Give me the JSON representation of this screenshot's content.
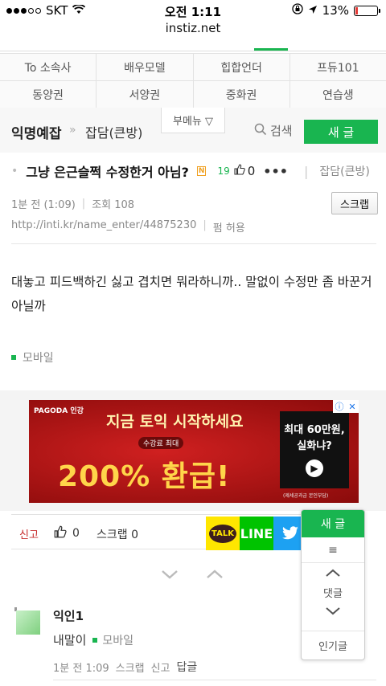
{
  "status_bar": {
    "carrier": "SKT",
    "time": "오전 1:11",
    "battery": "13%",
    "battery_level": 0.13
  },
  "browser": {
    "url": "instiz.net"
  },
  "categories": [
    [
      "To 소속사",
      "배우모델",
      "힙합언더",
      "프듀101"
    ],
    [
      "동양권",
      "서양권",
      "중화권",
      "연습생"
    ]
  ],
  "board": {
    "title": "익명예잡",
    "separator": "»",
    "sub": "잡담(큰방)",
    "submenu": "부메뉴 ▽",
    "search": "검색",
    "new_post": "새 글"
  },
  "post": {
    "bullet": "•",
    "title": "그냥 은근슬쩍 수정한거 아님?",
    "new_badge": "N",
    "comment_count": "19",
    "likes": "0",
    "more": "•••",
    "category": "잡담(큰방)",
    "time": "1분 전 (1:09)",
    "views": "조회 108",
    "scrap_button": "스크랩",
    "url": "http://inti.kr/name_enter/44875230",
    "permission": "펌 허용",
    "body": "대놓고 피드백하긴 싫고 겹치면 뭐라하니까.. 말없이 수정만 좀 바꾼거 아닐까",
    "device": "모바일"
  },
  "ad": {
    "brand": "PAGODA 인강",
    "headline": "지금 토익 시작하세요",
    "tag": "수강료 최대",
    "big": "200% 환급!",
    "box_line1": "최대 60만원,",
    "box_line2": "실화냐?",
    "fine": "(제세공과금 본인부담)"
  },
  "actions": {
    "report": "신고",
    "likes": "0",
    "scrap": "스크랩 0",
    "kakao": "TALK",
    "line": "LINE",
    "twitter": "🐦"
  },
  "nav_arrows": {
    "down": "⌄",
    "up": "⌃"
  },
  "comment": {
    "name": "익인1",
    "text": "내말이",
    "device": "모바일",
    "time": "1분 전 1:09",
    "scrap": "스크랩",
    "report": "신고",
    "reply": "답글"
  },
  "floating": {
    "new": "새 글",
    "menu": "≡",
    "up": "︿",
    "comments": "댓글",
    "down": "﹀",
    "popular": "인기글"
  },
  "colors": {
    "accent": "#19b550",
    "report": "#c62828"
  }
}
